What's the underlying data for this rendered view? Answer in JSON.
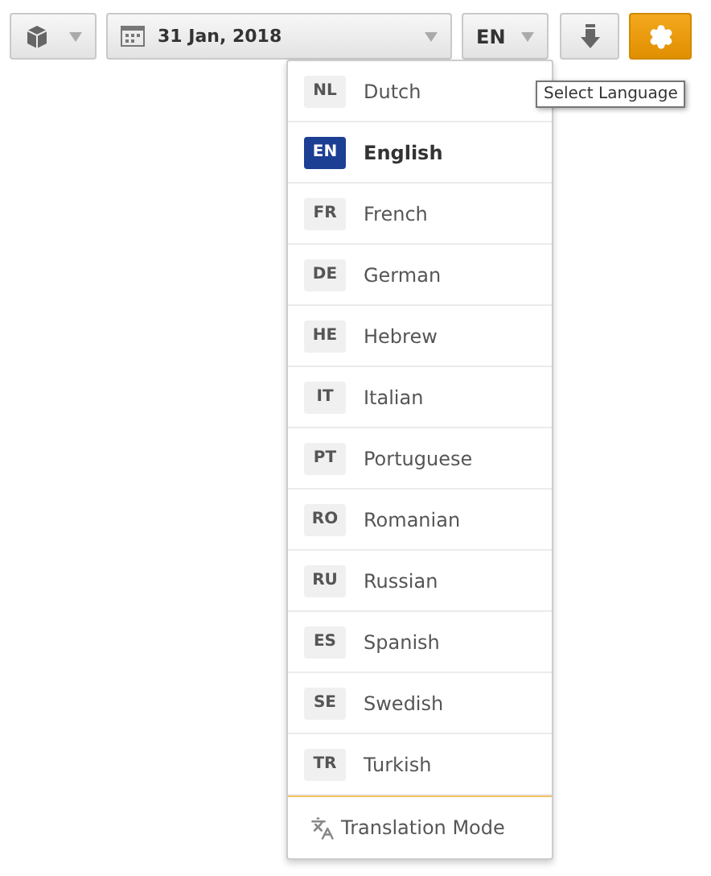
{
  "toolbar": {
    "date": "31 Jan, 2018",
    "language_button": "EN",
    "tooltip": "Select Language"
  },
  "languages": [
    {
      "code": "NL",
      "name": "Dutch",
      "selected": false
    },
    {
      "code": "EN",
      "name": "English",
      "selected": true
    },
    {
      "code": "FR",
      "name": "French",
      "selected": false
    },
    {
      "code": "DE",
      "name": "German",
      "selected": false
    },
    {
      "code": "HE",
      "name": "Hebrew",
      "selected": false
    },
    {
      "code": "IT",
      "name": "Italian",
      "selected": false
    },
    {
      "code": "PT",
      "name": "Portuguese",
      "selected": false
    },
    {
      "code": "RO",
      "name": "Romanian",
      "selected": false
    },
    {
      "code": "RU",
      "name": "Russian",
      "selected": false
    },
    {
      "code": "ES",
      "name": "Spanish",
      "selected": false
    },
    {
      "code": "SE",
      "name": "Swedish",
      "selected": false
    },
    {
      "code": "TR",
      "name": "Turkish",
      "selected": false
    }
  ],
  "footer": {
    "label": "Translation Mode"
  }
}
